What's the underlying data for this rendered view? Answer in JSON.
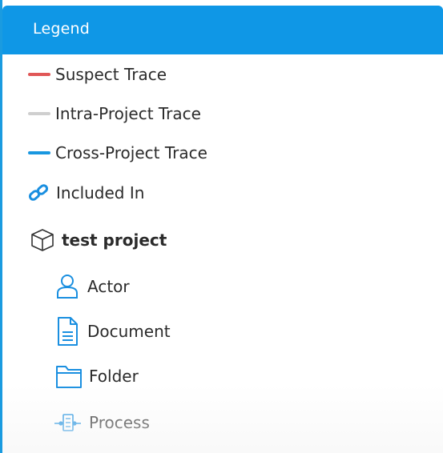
{
  "legend": {
    "title": "Legend",
    "traces": [
      {
        "label": "Suspect Trace",
        "color": "#e05757"
      },
      {
        "label": "Intra-Project Trace",
        "color": "#cfcfcf"
      },
      {
        "label": "Cross-Project Trace",
        "color": "#1997e0"
      }
    ],
    "included_in": {
      "label": "Included In",
      "icon": "link-icon",
      "color": "#1a8fe0"
    },
    "project": {
      "label": "test project",
      "icon": "cube-icon"
    },
    "types": [
      {
        "label": "Actor",
        "icon": "person-icon"
      },
      {
        "label": "Document",
        "icon": "document-icon"
      },
      {
        "label": "Folder",
        "icon": "folder-icon"
      },
      {
        "label": "Process",
        "icon": "process-icon"
      }
    ],
    "icon_color": "#1a8fe0"
  }
}
